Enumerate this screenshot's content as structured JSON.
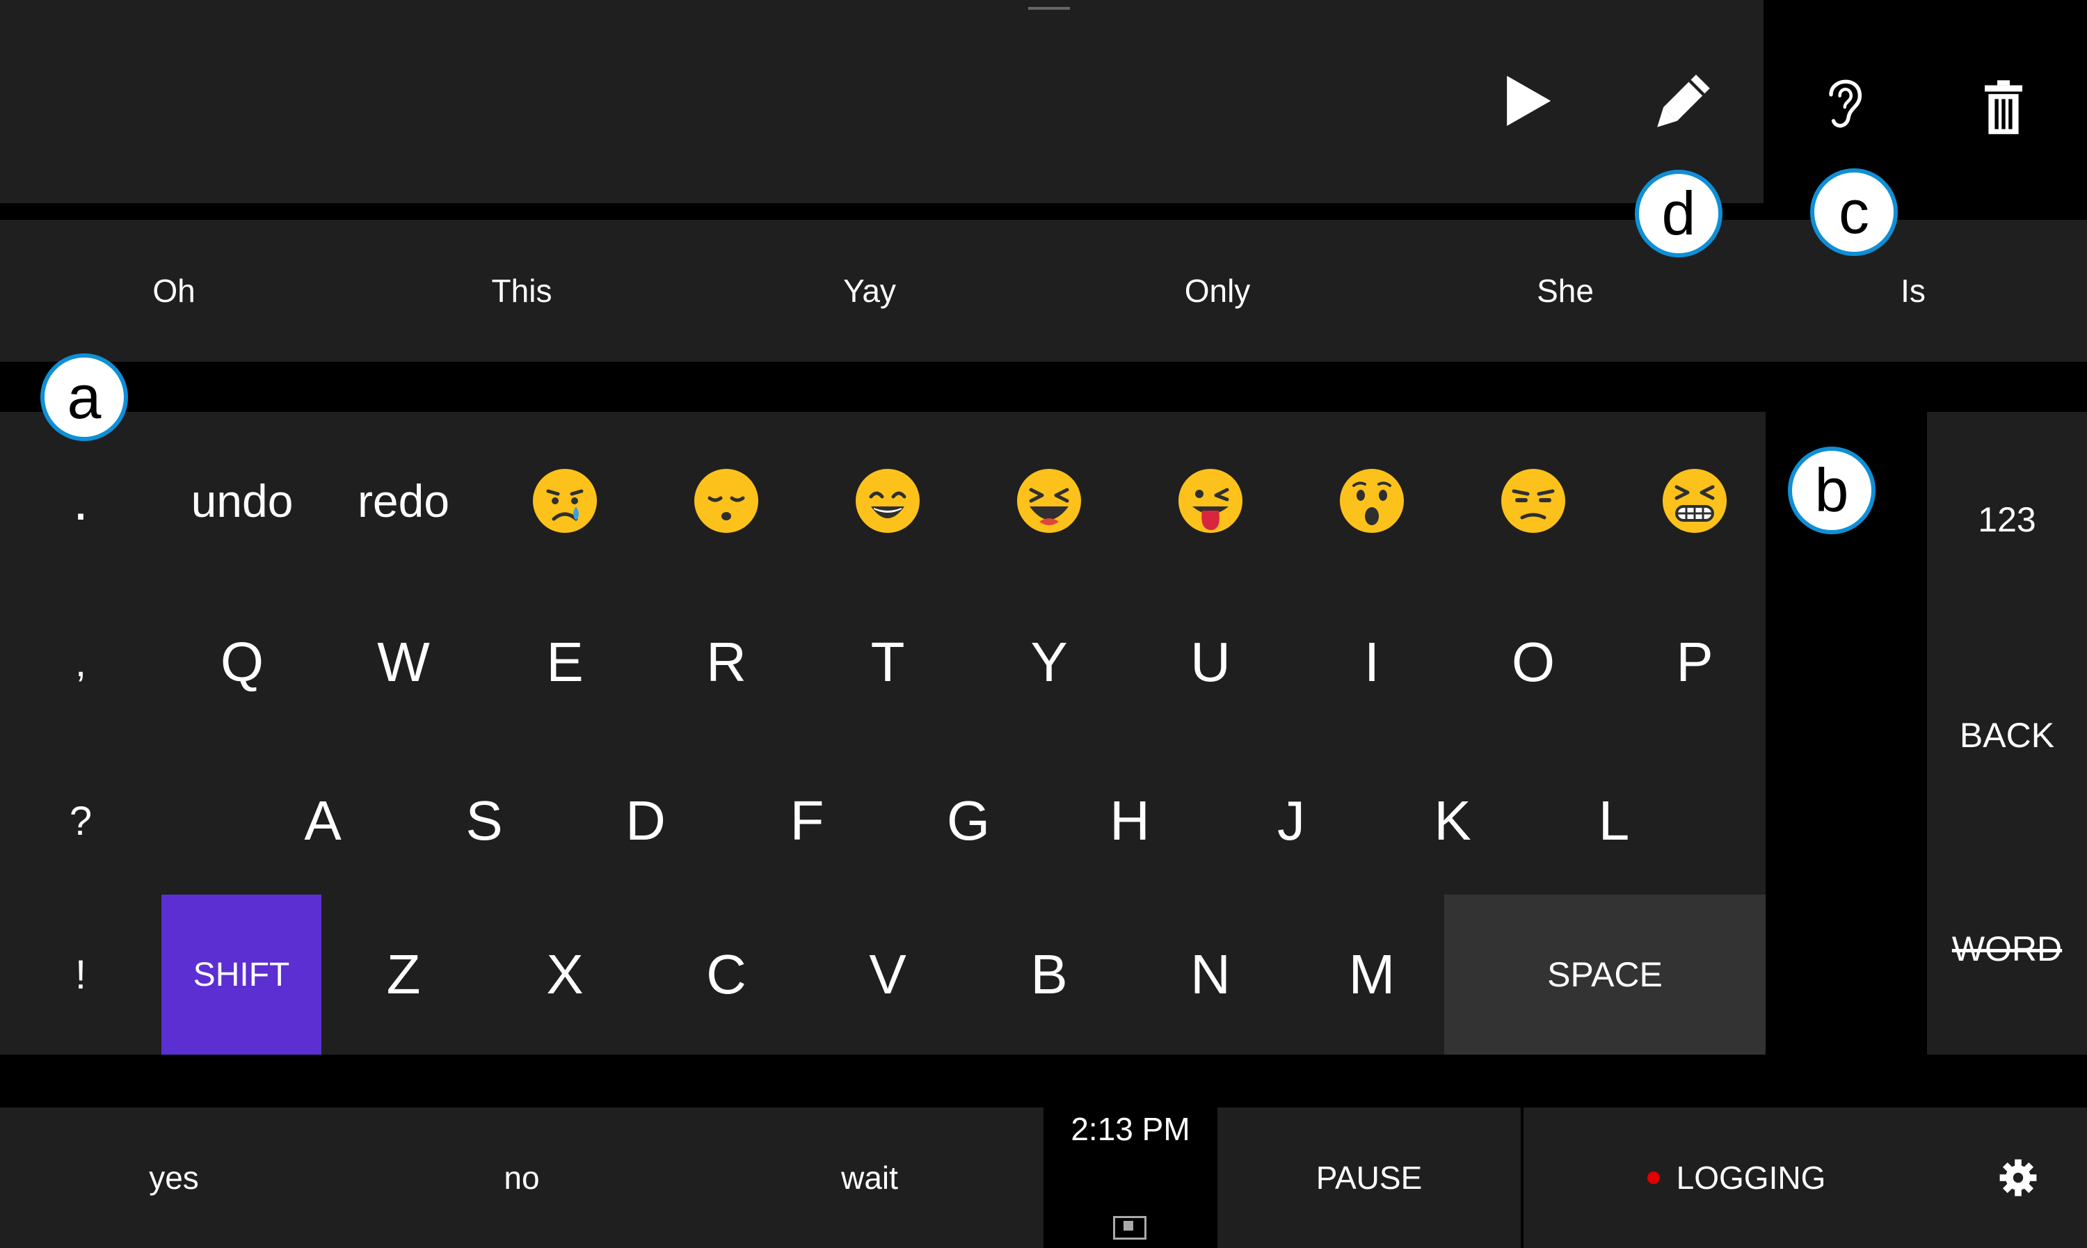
{
  "toolbar": {
    "play_icon": "play-icon",
    "edit_icon": "pencil-icon",
    "listen_icon": "ear-icon",
    "delete_icon": "trash-icon"
  },
  "predictions": [
    "Oh",
    "This",
    "Yay",
    "Only",
    "She",
    "Is"
  ],
  "keyboard": {
    "row0": {
      "punct": ".",
      "undo": "undo",
      "redo": "redo",
      "emojis": [
        "crying-emoji",
        "sleepy-emoji",
        "smiling-emoji",
        "laughing-emoji",
        "tongue-out-emoji",
        "surprised-emoji",
        "unamused-emoji",
        "grimacing-emoji"
      ]
    },
    "row1": {
      "punct": ",",
      "keys": [
        "Q",
        "W",
        "E",
        "R",
        "T",
        "Y",
        "U",
        "I",
        "O",
        "P"
      ]
    },
    "row2": {
      "punct": "?",
      "keys": [
        "A",
        "S",
        "D",
        "F",
        "G",
        "H",
        "J",
        "K",
        "L"
      ]
    },
    "row3": {
      "punct": "!",
      "shift": "SHIFT",
      "keys": [
        "Z",
        "X",
        "C",
        "V",
        "B",
        "N",
        "M"
      ],
      "space": "SPACE"
    },
    "accent_color": "#5b2fd1"
  },
  "side_keys": {
    "numbers": "123",
    "back": "BACK",
    "word": "WORD"
  },
  "callouts": {
    "a": "a",
    "b": "b",
    "c": "c",
    "d": "d"
  },
  "bottom": {
    "quick": [
      "yes",
      "no",
      "wait"
    ],
    "time": "2:13 PM",
    "pause": "PAUSE",
    "logging": "LOGGING",
    "logging_color": "#e00000"
  }
}
